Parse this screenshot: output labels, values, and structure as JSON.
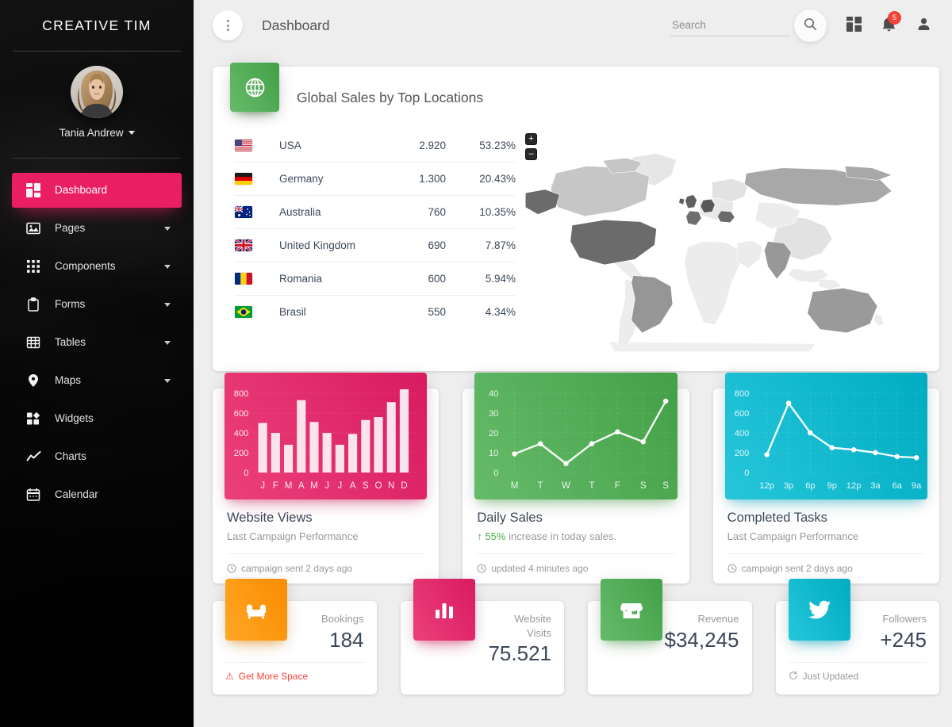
{
  "sidebar": {
    "brand": "CREATIVE TIM",
    "user": {
      "name": "Tania Andrew",
      "avatar_icon": "user-avatar-photo"
    },
    "items": [
      {
        "label": "Dashboard",
        "icon": "dashboard-icon",
        "active": true,
        "has_caret": false
      },
      {
        "label": "Pages",
        "icon": "image-icon",
        "active": false,
        "has_caret": true
      },
      {
        "label": "Components",
        "icon": "apps-grid-icon",
        "active": false,
        "has_caret": true
      },
      {
        "label": "Forms",
        "icon": "clipboard-icon",
        "active": false,
        "has_caret": true
      },
      {
        "label": "Tables",
        "icon": "table-grid-icon",
        "active": false,
        "has_caret": true
      },
      {
        "label": "Maps",
        "icon": "map-pin-icon",
        "active": false,
        "has_caret": true
      },
      {
        "label": "Widgets",
        "icon": "widgets-icon",
        "active": false,
        "has_caret": false
      },
      {
        "label": "Charts",
        "icon": "line-chart-icon",
        "active": false,
        "has_caret": false
      },
      {
        "label": "Calendar",
        "icon": "calendar-icon",
        "active": false,
        "has_caret": false
      }
    ]
  },
  "topbar": {
    "menu_icon": "vertical-dots-icon",
    "title": "Dashboard",
    "search": {
      "value": "",
      "placeholder": "Search"
    },
    "search_icon": "search-icon",
    "dashboard_icon": "dashboard-grid-icon",
    "notifications_icon": "bell-icon",
    "notifications_count": "5",
    "profile_icon": "person-icon"
  },
  "global_sales": {
    "icon": "globe-icon",
    "title": "Global Sales by Top Locations",
    "rows": [
      {
        "flag": "us-flag",
        "country": "USA",
        "value": "2.920",
        "percent": "53.23%"
      },
      {
        "flag": "de-flag",
        "country": "Germany",
        "value": "1.300",
        "percent": "20.43%"
      },
      {
        "flag": "au-flag",
        "country": "Australia",
        "value": "760",
        "percent": "10.35%"
      },
      {
        "flag": "gb-flag",
        "country": "United Kingdom",
        "value": "690",
        "percent": "7.87%"
      },
      {
        "flag": "ro-flag",
        "country": "Romania",
        "value": "600",
        "percent": "5.94%"
      },
      {
        "flag": "br-flag",
        "country": "Brasil",
        "value": "550",
        "percent": "4.34%"
      }
    ],
    "map": {
      "zoom_in_label": "+",
      "zoom_out_label": "–",
      "highlighted": [
        "USA",
        "Germany",
        "Australia",
        "United Kingdom",
        "Romania",
        "Brasil",
        "Russia",
        "India",
        "France",
        "Canada"
      ]
    }
  },
  "chart_data": [
    {
      "type": "bar",
      "title": "Website Views",
      "subtitle": "Last Campaign Performance",
      "footer": "campaign sent 2 days ago",
      "footer_icon": "clock-icon",
      "color": "#e91e63",
      "categories": [
        "J",
        "F",
        "M",
        "A",
        "M",
        "J",
        "J",
        "A",
        "S",
        "O",
        "N",
        "D"
      ],
      "values": [
        500,
        400,
        280,
        730,
        510,
        400,
        280,
        390,
        530,
        560,
        710,
        840
      ],
      "yticks": [
        0,
        200,
        400,
        600,
        800
      ],
      "ylim": [
        0,
        900
      ],
      "xlabel": "",
      "ylabel": "",
      "grid": true,
      "legend": false
    },
    {
      "type": "line",
      "title": "Daily Sales",
      "subtitle_highlight": "55%",
      "subtitle": "increase in today sales.",
      "subtitle_icon": "arrow-up-icon",
      "footer": "updated 4 minutes ago",
      "footer_icon": "clock-icon",
      "color": "#4caf50",
      "categories": [
        "M",
        "T",
        "W",
        "T",
        "F",
        "S",
        "S"
      ],
      "values": [
        9.5,
        14.5,
        4.5,
        14.5,
        20.5,
        15.5,
        36
      ],
      "yticks": [
        0,
        10,
        20,
        30,
        40
      ],
      "ylim": [
        0,
        45
      ],
      "xlabel": "",
      "ylabel": "",
      "grid": true,
      "legend": false
    },
    {
      "type": "line",
      "title": "Completed Tasks",
      "subtitle": "Last Campaign Performance",
      "footer": "campaign sent 2 days ago",
      "footer_icon": "clock-icon",
      "color": "#00bcd4",
      "categories": [
        "12p",
        "3p",
        "6p",
        "9p",
        "12p",
        "3a",
        "6a",
        "9a"
      ],
      "values": [
        180,
        700,
        400,
        250,
        230,
        200,
        160,
        150
      ],
      "yticks": [
        0,
        200,
        400,
        600,
        800
      ],
      "ylim": [
        0,
        900
      ],
      "xlabel": "",
      "ylabel": "",
      "grid": true,
      "legend": false
    }
  ],
  "stats": [
    {
      "icon": "sofa-icon",
      "color": "orange",
      "label": "Bookings",
      "value": "184",
      "foot_icon": "warning-icon",
      "foot": "Get More Space"
    },
    {
      "icon": "bar-chart-icon",
      "color": "pink",
      "label": "Website\nVisits",
      "value": "75.521",
      "foot_icon": "",
      "foot": ""
    },
    {
      "icon": "store-icon",
      "color": "green",
      "label": "Revenue",
      "value": "$34,245",
      "foot_icon": "",
      "foot": ""
    },
    {
      "icon": "twitter-icon",
      "color": "cyan",
      "label": "Followers",
      "value": "+245",
      "foot_icon": "update-icon",
      "foot": "Just Updated"
    }
  ],
  "theme": {
    "accent_pink": "#e91e63",
    "green": "#4caf50",
    "cyan": "#00bcd4",
    "orange": "#ff9800",
    "red_badge": "#f44336",
    "page_bg": "#eeeeee",
    "sidebar_bg": "#0d0d0d"
  }
}
